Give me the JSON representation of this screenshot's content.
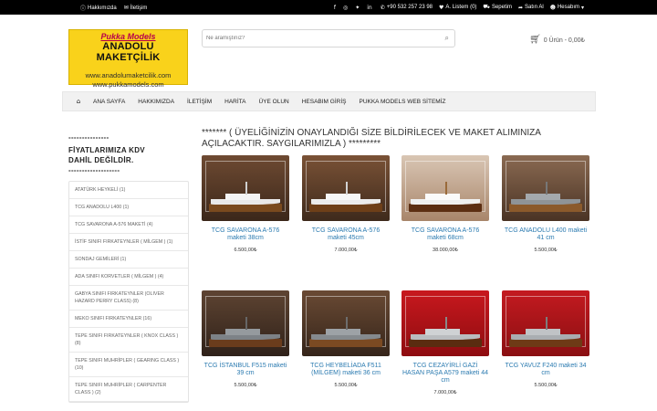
{
  "topbar": {
    "about": "Hakkımızda",
    "contact": "İletişim",
    "phone": "+90 532 257 23 98",
    "wishlist": "A. Listem (0)",
    "basket": "Sepetim",
    "checkout": "Satın Al",
    "account": "Hesabım"
  },
  "logo": {
    "line1": "Pukka Models",
    "line2": "ANADOLU MAKETÇİLİK",
    "line3": "www.anadolumaketcilik.com",
    "line4": "www.pukkamodels.com"
  },
  "search": {
    "placeholder": "Ne aramıştınız?"
  },
  "cart": {
    "label": "0 Ürün - 0,00₺"
  },
  "nav": {
    "items": [
      "ANA SAYFA",
      "HAKKIMIZDA",
      "İLETİŞİM",
      "HARİTA",
      "ÜYE OLUN",
      "HESABIM GİRİŞ",
      "PUKKA MODELS WEB SİTEMİZ"
    ]
  },
  "sidebar": {
    "title1": "---------------",
    "title2": "FİYATLARIMIZA  KDV",
    "title3": "DAHİL DEĞİLDİR.",
    "title4": "-------------------",
    "categories": [
      "ATATÜRK HEYKELİ (1)",
      "TCG ANADOLU L400 (1)",
      "TCG SAVARONA A-576 MAKETİ (4)",
      "İSTİF SINIFI FIRKATEYNLER ( MİLGEM ) (1)",
      "SONDAJ GEMİLERİ (1)",
      "ADA SINIFI KORVETLER ( MİLGEM ) (4)",
      "GABYA SINIFI FIRKATEYNLER (OLIVER HAZARD PERRY CLASS) (8)",
      "MEKO SINIFI FIRKATEYNLER (16)",
      "TEPE SINIFI FIRKATEYNLER ( KNOX CLASS ) (8)",
      "TEPE SINIFI MUHRİPLER ( GEARING CLASS ) (10)",
      "TEPE SINIFI MUHRİPLER ( CARPENTER CLASS ) (2)"
    ]
  },
  "notice": "******* ( ÜYELİĞİNİZİN ONAYLANDIĞI SİZE BİLDİRİLECEK VE MAKET ALIMINIZA AÇILACAKTIR. SAYGILARIMIZLA ) *********",
  "products": [
    {
      "name": "TCG SAVARONA A-576 maketi 38cm",
      "price": "6.500,00₺"
    },
    {
      "name": "TCG SAVARONA A-576 maketi 45cm",
      "price": "7.000,00₺"
    },
    {
      "name": "TCG SAVARONA A-576 maketi 68cm",
      "price": "38.000,00₺"
    },
    {
      "name": "TCG ANADOLU L400 maketi 41 cm",
      "price": "5.500,00₺"
    },
    {
      "name": "TCG İSTANBUL F515 maketi 39 cm",
      "price": "5.500,00₺"
    },
    {
      "name": "TCG HEYBELİADA F511 (MİLGEM) maketi 36 cm",
      "price": "5.500,00₺"
    },
    {
      "name": "TCG CEZAYİRLİ GAZİ HASAN PAŞA A579 maketi 44 cm",
      "price": "7.000,00₺"
    },
    {
      "name": "TCG YAVUZ F240 maketi 34 cm",
      "price": "5.500,00₺"
    }
  ],
  "icons": {
    "info": "info-icon",
    "envelope": "envelope-icon",
    "facebook": "facebook-icon",
    "instagram": "instagram-icon",
    "twitter": "twitter-icon",
    "linkedin": "linkedin-icon",
    "phone": "phone-icon",
    "heart": "heart-icon",
    "cart": "cart-icon",
    "share": "share-icon",
    "user": "user-icon",
    "search": "search-icon",
    "home": "home-icon"
  },
  "colors": {
    "topbar": "#000000",
    "logo_bg": "#f9d21b",
    "link": "#2a7ab0",
    "nav_bg": "#f1f1f1"
  }
}
